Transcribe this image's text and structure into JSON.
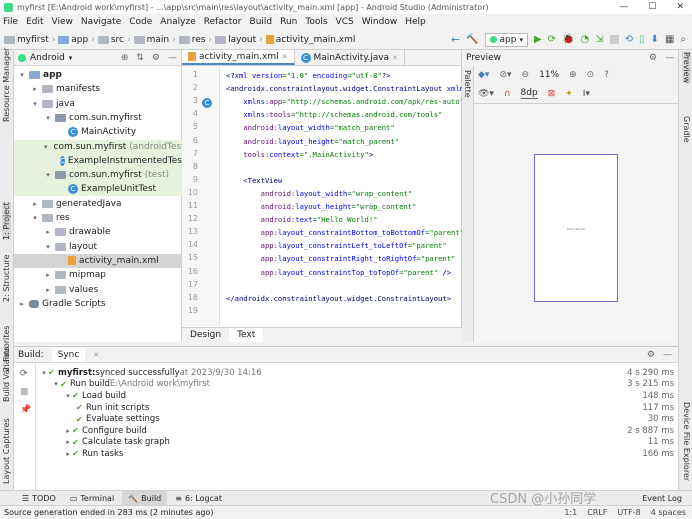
{
  "window": {
    "title": "myfirst [E:\\Android work\\myfirst] - ...\\app\\src\\main\\res\\layout\\activity_main.xml [app] - Android Studio (Administrator)"
  },
  "menu": [
    "File",
    "Edit",
    "View",
    "Navigate",
    "Code",
    "Analyze",
    "Refactor",
    "Build",
    "Run",
    "Tools",
    "VCS",
    "Window",
    "Help"
  ],
  "breadcrumbs": [
    "myfirst",
    "app",
    "src",
    "main",
    "res",
    "layout",
    "activity_main.xml"
  ],
  "run_config": "app",
  "left_strip": [
    "Resource Manager",
    "1: Project",
    "2: Structure",
    "2: Favorites",
    "Build Variants",
    "Layout Captures"
  ],
  "right_strip": [
    "Preview",
    "Gradle",
    "Device File Explorer"
  ],
  "project": {
    "view_mode": "Android",
    "tree": [
      {
        "label": "app",
        "level": 0,
        "kind": "module",
        "arrow": "▾",
        "bold": true
      },
      {
        "label": "manifests",
        "level": 1,
        "kind": "folder",
        "arrow": "▸"
      },
      {
        "label": "java",
        "level": 1,
        "kind": "folder",
        "arrow": "▾"
      },
      {
        "label": "com.sun.myfirst",
        "level": 2,
        "kind": "package",
        "arrow": "▾"
      },
      {
        "label": "MainActivity",
        "level": 3,
        "kind": "class"
      },
      {
        "label": "com.sun.myfirst",
        "suffix": " (androidTest)",
        "level": 2,
        "kind": "package",
        "arrow": "▾",
        "green": true
      },
      {
        "label": "ExampleInstrumentedTest",
        "level": 3,
        "kind": "class",
        "green": true
      },
      {
        "label": "com.sun.myfirst",
        "suffix": " (test)",
        "level": 2,
        "kind": "package",
        "arrow": "▾",
        "green": true
      },
      {
        "label": "ExampleUnitTest",
        "level": 3,
        "kind": "class",
        "green": true
      },
      {
        "label": "generatedJava",
        "level": 1,
        "kind": "folder",
        "arrow": "▸"
      },
      {
        "label": "res",
        "level": 1,
        "kind": "folder",
        "arrow": "▾"
      },
      {
        "label": "drawable",
        "level": 2,
        "kind": "folder",
        "arrow": "▸"
      },
      {
        "label": "layout",
        "level": 2,
        "kind": "folder",
        "arrow": "▾"
      },
      {
        "label": "activity_main.xml",
        "level": 3,
        "kind": "xml",
        "selected": true
      },
      {
        "label": "mipmap",
        "level": 2,
        "kind": "folder",
        "arrow": "▸"
      },
      {
        "label": "values",
        "level": 2,
        "kind": "folder",
        "arrow": "▸"
      },
      {
        "label": "Gradle Scripts",
        "level": 0,
        "kind": "gradle",
        "arrow": "▸"
      }
    ]
  },
  "editor": {
    "tabs": [
      "activity_main.xml",
      "MainActivity.java"
    ],
    "lines": [
      [
        {
          "t": "<?",
          "c": "tag"
        },
        {
          "t": "xml version",
          "c": "attr"
        },
        {
          "t": "=\"1.0\" ",
          "c": "val"
        },
        {
          "t": "encoding",
          "c": "attr"
        },
        {
          "t": "=\"utf-8\"",
          "c": "val"
        },
        {
          "t": "?>",
          "c": "tag"
        }
      ],
      [
        {
          "t": "<androidx.constraintlayout.widget.ConstraintLayout ",
          "c": "tag"
        },
        {
          "t": "xmlns:",
          "c": "attr"
        }
      ],
      [
        {
          "t": "    xmlns:",
          "c": "attr"
        },
        {
          "t": "app",
          "c": "ns"
        },
        {
          "t": "=\"http://schemas.android.com/apk/res-auto\"",
          "c": "val"
        }
      ],
      [
        {
          "t": "    xmlns:",
          "c": "attr"
        },
        {
          "t": "tools",
          "c": "ns"
        },
        {
          "t": "=\"http://schemas.android.com/tools\"",
          "c": "val"
        }
      ],
      [
        {
          "t": "    android:",
          "c": "ns"
        },
        {
          "t": "layout_width",
          "c": "attr"
        },
        {
          "t": "=\"match_parent\"",
          "c": "val"
        }
      ],
      [
        {
          "t": "    android:",
          "c": "ns"
        },
        {
          "t": "layout_height",
          "c": "attr"
        },
        {
          "t": "=\"match_parent\"",
          "c": "val"
        }
      ],
      [
        {
          "t": "    tools:",
          "c": "ns"
        },
        {
          "t": "context",
          "c": "attr"
        },
        {
          "t": "=\".MainActivity\"",
          "c": "val"
        },
        {
          "t": ">",
          "c": "tag"
        }
      ],
      [],
      [
        {
          "t": "    <TextView",
          "c": "tag"
        }
      ],
      [
        {
          "t": "        android:",
          "c": "ns"
        },
        {
          "t": "layout_width",
          "c": "attr"
        },
        {
          "t": "=\"wrap_content\"",
          "c": "val"
        }
      ],
      [
        {
          "t": "        android:",
          "c": "ns"
        },
        {
          "t": "layout_height",
          "c": "attr"
        },
        {
          "t": "=\"wrap_content\"",
          "c": "val"
        }
      ],
      [
        {
          "t": "        android:",
          "c": "ns"
        },
        {
          "t": "text",
          "c": "attr"
        },
        {
          "t": "=\"Hello World!\"",
          "c": "val"
        }
      ],
      [
        {
          "t": "        app:",
          "c": "ns"
        },
        {
          "t": "layout_constraintBottom_toBottomOf",
          "c": "attr"
        },
        {
          "t": "=\"parent\"",
          "c": "val"
        }
      ],
      [
        {
          "t": "        app:",
          "c": "ns"
        },
        {
          "t": "layout_constraintLeft_toLeftOf",
          "c": "attr"
        },
        {
          "t": "=\"parent\"",
          "c": "val"
        }
      ],
      [
        {
          "t": "        app:",
          "c": "ns"
        },
        {
          "t": "layout_constraintRight_toRightOf",
          "c": "attr"
        },
        {
          "t": "=\"parent\"",
          "c": "val"
        }
      ],
      [
        {
          "t": "        app:",
          "c": "ns"
        },
        {
          "t": "layout_constraintTop_toTopOf",
          "c": "attr"
        },
        {
          "t": "=\"parent\" ",
          "c": "val"
        },
        {
          "t": "/>",
          "c": "tag"
        }
      ],
      [],
      [
        {
          "t": "</androidx.constraintlayout.widget.ConstraintLayout>",
          "c": "tag"
        }
      ],
      []
    ],
    "bottom_tabs": [
      "Design",
      "Text"
    ]
  },
  "preview": {
    "title": "Preview",
    "zoom": "11%",
    "dp": "8dp",
    "palette_label": "Palette",
    "hello_text": "Hello World!"
  },
  "build": {
    "tabs": [
      "Build:",
      "Sync"
    ],
    "rows": [
      {
        "level": 0,
        "text": "myfirst:",
        "rest": " synced successfully",
        "time_txt": " at 2023/9/30 14:16",
        "time": "4 s 290 ms",
        "bold": true
      },
      {
        "level": 1,
        "text": "Run build",
        "rest": " E:\\Android work\\myfirst",
        "time": "3 s 215 ms"
      },
      {
        "level": 2,
        "text": "Load build",
        "time": "148 ms"
      },
      {
        "level": 3,
        "text": "Run init scripts",
        "time": "117 ms"
      },
      {
        "level": 3,
        "text": "Evaluate settings",
        "time": "30 ms"
      },
      {
        "level": 2,
        "text": "Configure build",
        "time": "2 s 887 ms"
      },
      {
        "level": 2,
        "text": "Calculate task graph",
        "time": "11 ms"
      },
      {
        "level": 2,
        "text": "Run tasks",
        "time": "166 ms"
      }
    ]
  },
  "toolwindows": [
    "TODO",
    "Terminal",
    "Build",
    "6: Logcat"
  ],
  "event_log": "Event Log",
  "status": {
    "message": "Source generation ended in 283 ms (2 minutes ago)",
    "position": "1:1",
    "line_sep": "CRLF",
    "encoding": "UTF-8",
    "indent": "4 spaces"
  },
  "watermark": "CSDN @小孙同学"
}
